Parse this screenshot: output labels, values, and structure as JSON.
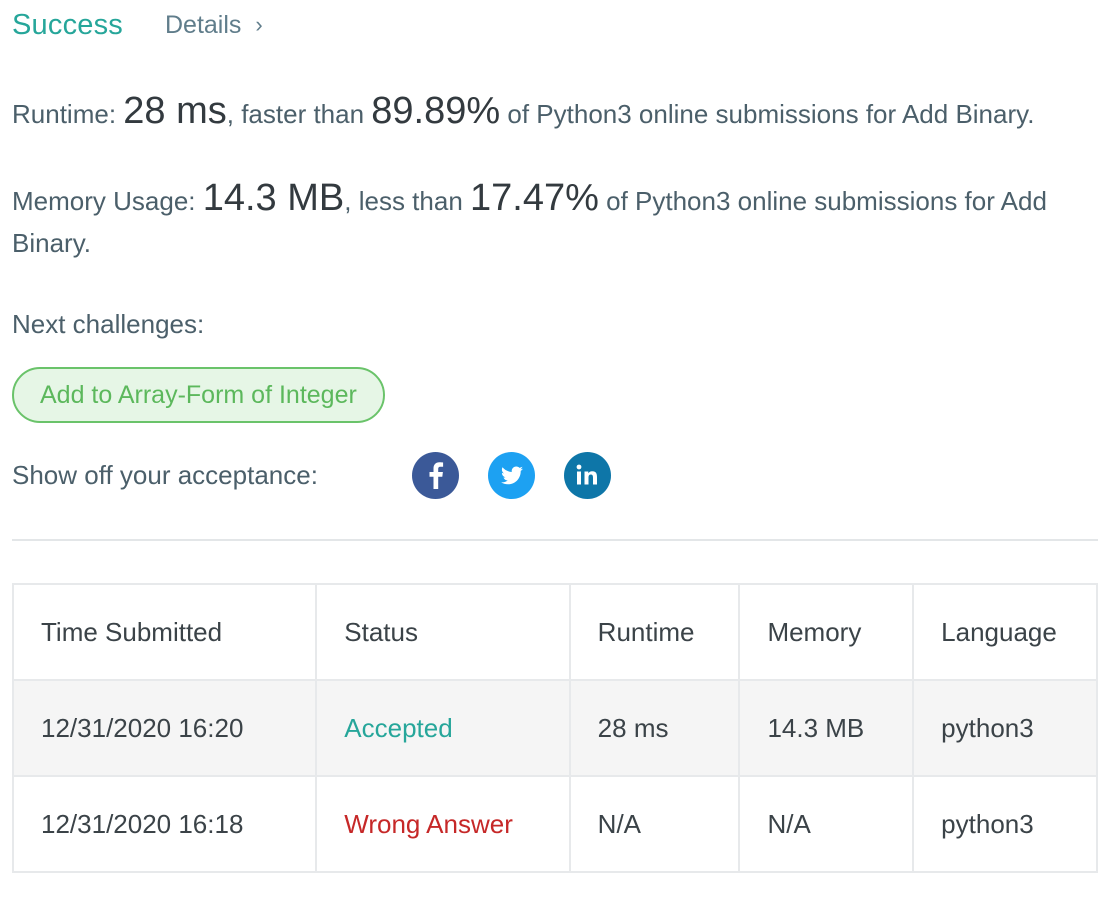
{
  "header": {
    "status": "Success",
    "details_label": "Details",
    "details_chevron": "›"
  },
  "runtime": {
    "label": "Runtime: ",
    "value": "28 ms",
    "middle": ", faster than ",
    "percent": "89.89%",
    "suffix": " of Python3 online submissions for Add Binary."
  },
  "memory": {
    "label": "Memory Usage: ",
    "value": "14.3 MB",
    "middle": ", less than ",
    "percent": "17.47%",
    "suffix": " of Python3 online submissions for Add Binary."
  },
  "next": {
    "label": "Next challenges:",
    "challenge": "Add to Array-Form of Integer"
  },
  "share": {
    "label": "Show off your acceptance:",
    "icons": [
      {
        "name": "facebook-icon",
        "color": "#3b5998"
      },
      {
        "name": "twitter-icon",
        "color": "#1da1f2"
      },
      {
        "name": "linkedin-icon",
        "color": "#0e76a8"
      }
    ]
  },
  "table": {
    "headers": [
      "Time Submitted",
      "Status",
      "Runtime",
      "Memory",
      "Language"
    ],
    "rows": [
      {
        "time": "12/31/2020 16:20",
        "status": "Accepted",
        "runtime": "28 ms",
        "memory": "14.3 MB",
        "language": "python3"
      },
      {
        "time": "12/31/2020 16:18",
        "status": "Wrong Answer",
        "runtime": "N/A",
        "memory": "N/A",
        "language": "python3"
      }
    ]
  },
  "colors": {
    "accent": "#26a69a",
    "wrong": "#c62828",
    "challenge_green": "#5cb85c"
  }
}
